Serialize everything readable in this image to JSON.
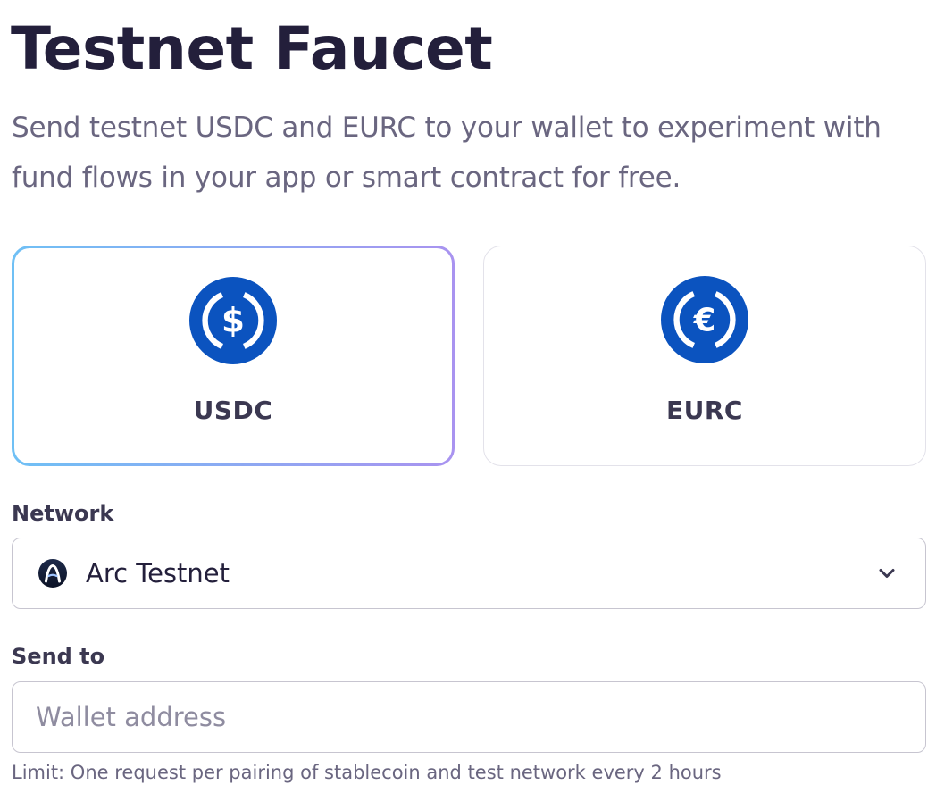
{
  "header": {
    "title": "Testnet Faucet",
    "subtitle": "Send testnet USDC and EURC to your wallet to experiment with fund flows in your app or smart contract for free."
  },
  "tokens": [
    {
      "label": "USDC",
      "icon": "usdc-dollar-coin-icon",
      "selected": true,
      "color": "#0b53bf"
    },
    {
      "label": "EURC",
      "icon": "eurc-euro-coin-icon",
      "selected": false,
      "color": "#0b53bf"
    }
  ],
  "network": {
    "label": "Network",
    "selected": "Arc Testnet",
    "icon": "arc-network-icon"
  },
  "send_to": {
    "label": "Send to",
    "placeholder": "Wallet address",
    "value": ""
  },
  "limit_note": "Limit: One request per pairing of stablecoin and test network every 2 hours",
  "colors": {
    "selected_border_start": "#6fc0f5",
    "selected_border_end": "#a993f0",
    "coin_blue": "#0b53bf",
    "title": "#231f3b",
    "muted_text": "#6a6680"
  }
}
